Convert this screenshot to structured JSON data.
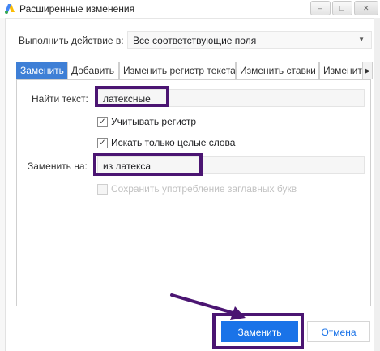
{
  "window": {
    "title": "Расширенные изменения",
    "controls": {
      "minimize": "–",
      "maximize": "□",
      "close": "✕"
    }
  },
  "action": {
    "label": "Выполнить действие в:",
    "selected": "Все соответствующие поля",
    "caret": "▼"
  },
  "tabs": [
    {
      "label": "Заменить",
      "active": true
    },
    {
      "label": "Добавить",
      "active": false
    },
    {
      "label": "Изменить регистр текста",
      "active": false
    },
    {
      "label": "Изменить ставки",
      "active": false
    },
    {
      "label": "Изменить URL",
      "active": false
    }
  ],
  "tab_scroll_icon": "▶",
  "replace_tab": {
    "find_label": "Найти текст:",
    "find_value": "латексные",
    "match_case_label": "Учитывать регистр",
    "match_case_checked": true,
    "whole_words_label": "Искать только целые слова",
    "whole_words_checked": true,
    "replace_label": "Заменить на:",
    "replace_value": "из латекса",
    "preserve_case_label": "Сохранить употребление заглавных букв",
    "preserve_case_checked": false,
    "preserve_case_enabled": false,
    "checkmark": "✓"
  },
  "footer": {
    "replace_button": "Заменить",
    "cancel_button": "Отмена"
  },
  "annotation_color": "#4b1572",
  "accent_color": "#1a73e8",
  "icons": {
    "app": "google-ads-icon",
    "arrow": "annotation-arrow-icon"
  }
}
